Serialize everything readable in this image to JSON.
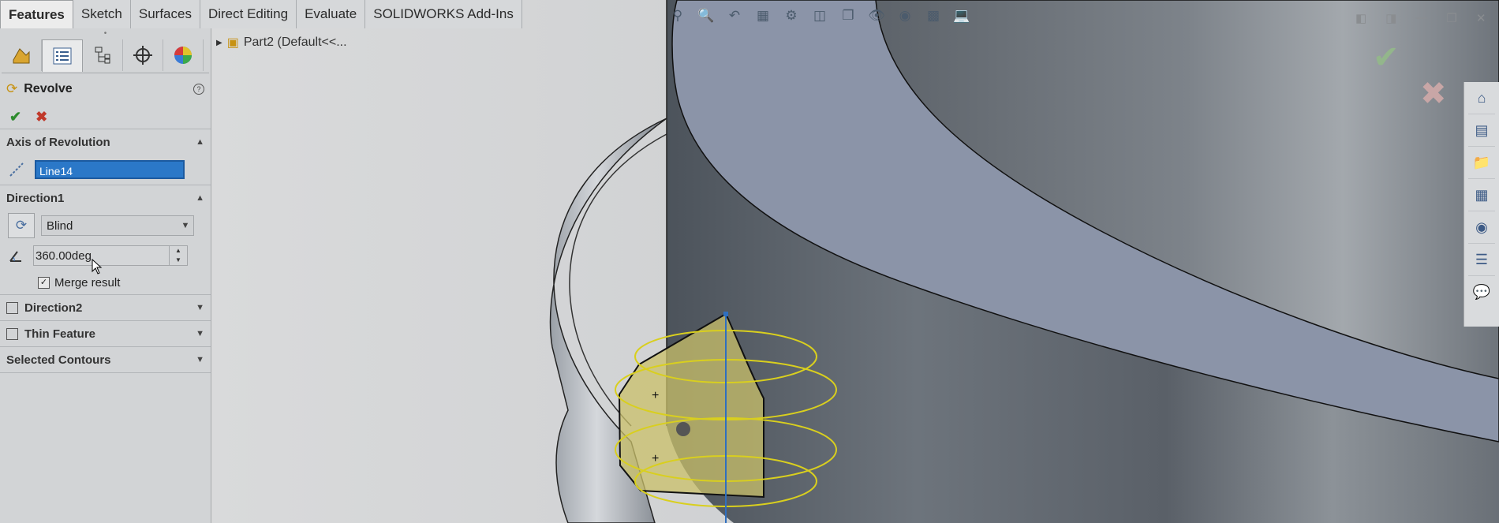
{
  "tabs": [
    "Features",
    "Sketch",
    "Surfaces",
    "Direct Editing",
    "Evaluate",
    "SOLIDWORKS Add-Ins"
  ],
  "active_tab": "Features",
  "property_manager": {
    "title": "Revolve",
    "sections": {
      "axis": {
        "label": "Axis of Revolution",
        "value": "Line14"
      },
      "direction1": {
        "label": "Direction1",
        "type": "Blind",
        "angle": "360.00deg",
        "merge_label": "Merge result",
        "merge_checked": true
      },
      "direction2": {
        "label": "Direction2"
      },
      "thin": {
        "label": "Thin Feature"
      },
      "contours": {
        "label": "Selected Contours"
      }
    }
  },
  "tree": {
    "item": "Part2  (Default<<..."
  },
  "icons": {
    "heads_up": [
      "zoom-to-fit-icon",
      "zoom-area-icon",
      "previous-view-icon",
      "section-view-icon",
      "dynamic-annotation-icon",
      "view-orientation-icon",
      "display-style-icon",
      "hide-show-icon",
      "appearance-icon",
      "scene-icon",
      "view-settings-icon"
    ],
    "task_pane": [
      "home-icon",
      "design-library-icon",
      "file-explorer-icon",
      "view-palette-icon",
      "appearances-icon",
      "custom-properties-icon",
      "forum-icon"
    ]
  },
  "colors": {
    "selection": "#2b78c8",
    "preview": "#d8cf3a",
    "model": "#5b6169"
  }
}
